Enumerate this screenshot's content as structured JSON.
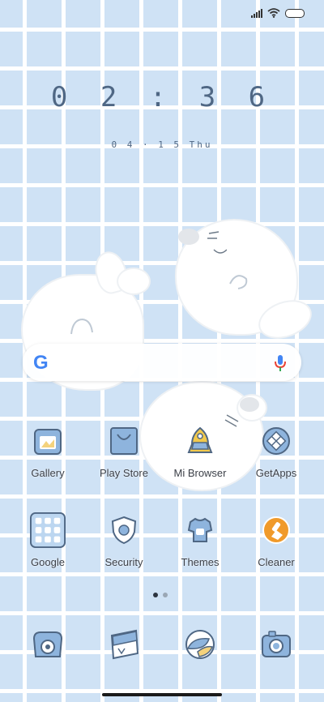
{
  "clock": {
    "time": "0 2 : 3 6",
    "date": "0 4 · 1 5  Thu"
  },
  "search": {
    "logo": "G"
  },
  "apps_row1": [
    {
      "label": "Gallery",
      "icon": "gallery-icon"
    },
    {
      "label": "Play Store",
      "icon": "play-store-icon"
    },
    {
      "label": "Mi Browser",
      "icon": "mi-browser-icon"
    },
    {
      "label": "GetApps",
      "icon": "getapps-icon"
    }
  ],
  "apps_row2": [
    {
      "label": "Google",
      "icon": "google-folder-icon"
    },
    {
      "label": "Security",
      "icon": "security-icon"
    },
    {
      "label": "Themes",
      "icon": "themes-icon"
    },
    {
      "label": "Cleaner",
      "icon": "cleaner-icon"
    }
  ],
  "dock": [
    {
      "icon": "phone-icon"
    },
    {
      "icon": "messages-icon"
    },
    {
      "icon": "chrome-icon"
    },
    {
      "icon": "camera-icon"
    }
  ],
  "page_indicator": {
    "pages": 2,
    "active": 1
  },
  "colors": {
    "accent": "#4f6784",
    "icon_blue": "#8eb4dd",
    "orange": "#f09a2a"
  }
}
